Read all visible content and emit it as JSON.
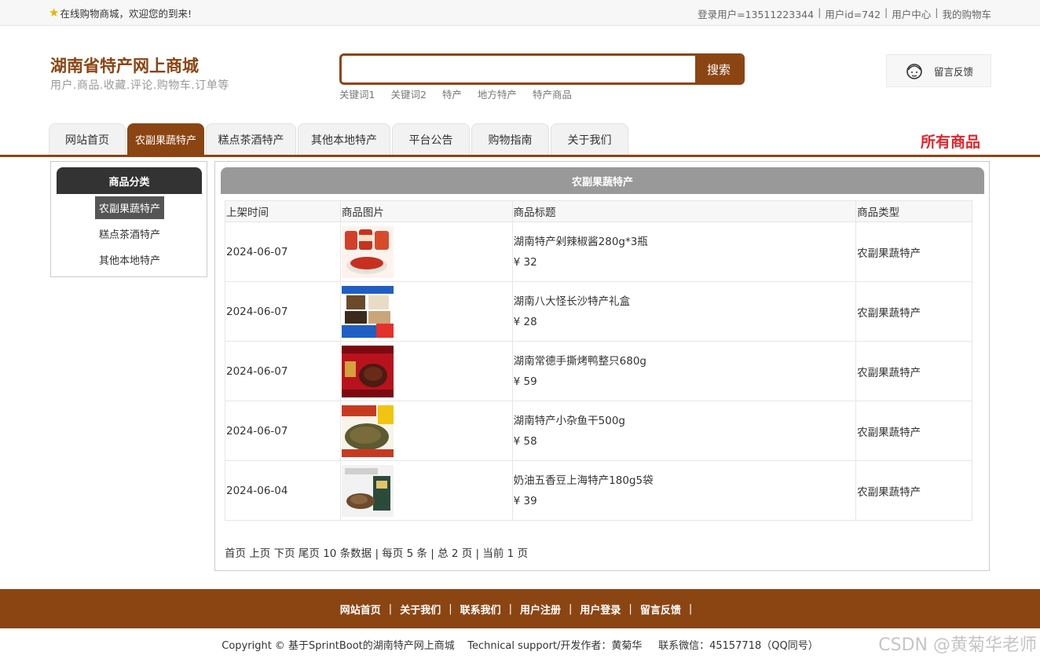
{
  "topbar": {
    "welcome": "在线购物商城，欢迎您的到来!",
    "links": [
      "登录用户=13511223344",
      "用户id=742",
      "用户中心",
      "我的购物车"
    ]
  },
  "header": {
    "site_title": "湖南省特产网上商城",
    "site_subtitle": "用户.商品.收藏.评论.购物车.订单等",
    "search": {
      "value": "",
      "placeholder": "",
      "button": "搜索"
    },
    "keywords": [
      "关键词1",
      "关键词2",
      "特产",
      "地方特产",
      "特产商品"
    ],
    "feedback": "留言反馈"
  },
  "nav": {
    "tabs": [
      "网站首页",
      "农副果蔬特产",
      "糕点茶酒特产",
      "其他本地特产",
      "平台公告",
      "购物指南",
      "关于我们"
    ],
    "active_index": 1,
    "all_goods": "所有商品"
  },
  "sidebar": {
    "heading": "商品分类",
    "items": [
      "农副果蔬特产",
      "糕点茶酒特产",
      "其他本地特产"
    ],
    "active_index": 0
  },
  "main": {
    "heading": "农副果蔬特产",
    "columns": [
      "上架时间",
      "商品图片",
      "商品标题",
      "商品类型"
    ],
    "rows": [
      {
        "date": "2024-06-07",
        "title": "湖南特产剁辣椒酱280g*3瓶",
        "price": "¥ 32",
        "type": "农副果蔬特产"
      },
      {
        "date": "2024-06-07",
        "title": "湖南八大怪长沙特产礼盒",
        "price": "¥ 28",
        "type": "农副果蔬特产"
      },
      {
        "date": "2024-06-07",
        "title": "湖南常德手撕烤鸭整只680g",
        "price": "¥ 59",
        "type": "农副果蔬特产"
      },
      {
        "date": "2024-06-07",
        "title": "湖南特产小杂鱼干500g",
        "price": "¥ 58",
        "type": "农副果蔬特产"
      },
      {
        "date": "2024-06-04",
        "title": "奶油五香豆上海特产180g5袋",
        "price": "¥ 39",
        "type": "农副果蔬特产"
      }
    ],
    "pager": {
      "first": "首页",
      "prev": "上页",
      "next": "下页",
      "last": "尾页",
      "info": "10 条数据 | 每页 5 条 | 总 2 页 | 当前 1 页"
    }
  },
  "footer": {
    "links": [
      "网站首页",
      "关于我们",
      "联系我们",
      "用户注册",
      "用户登录",
      "留言反馈"
    ],
    "copyright": "Copyright © 基于SprintBoot的湖南特产网上商城    Technical support/开发作者：黄菊华     联系微信：45157718（QQ同号）",
    "watermark": "CSDN @黄菊华老师"
  },
  "colors": {
    "brand": "#8b4513",
    "all_goods": "#e8232b",
    "side_head": "#333333",
    "main_head": "#999999"
  },
  "icons": [
    "star-icon",
    "customer-service-icon"
  ]
}
